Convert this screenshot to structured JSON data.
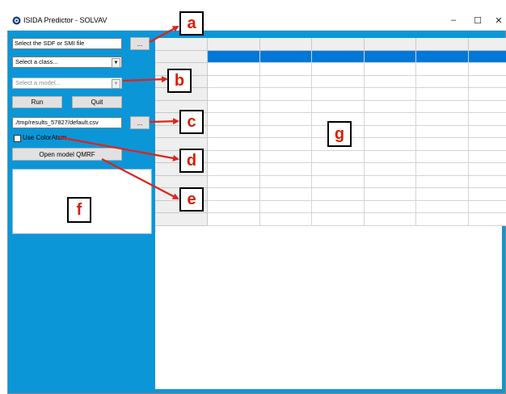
{
  "window": {
    "title": "ISIDA Predictor - SOLVAV",
    "controls": {
      "minimize": "–",
      "maximize": "☐",
      "close": "✕"
    }
  },
  "left_panel": {
    "file_field": "Select the SDF or SMI file",
    "browse_label": "...",
    "class_combo": "Select a class...",
    "model_combo": "Select a model...",
    "run_label": "Run",
    "quit_label": "Quit",
    "output_path": "./tmp/results_57827/default.csv",
    "output_browse_label": "...",
    "use_coloratom_label": "Use ColorAtom",
    "use_coloratom_checked": false,
    "open_qmrf_label": "Open model QMRF"
  },
  "grid": {
    "columns": 6,
    "rows": 14,
    "selected_row": 1
  },
  "callouts": {
    "a": "a",
    "b": "b",
    "c": "c",
    "d": "d",
    "e": "e",
    "f": "f",
    "g": "g"
  },
  "colors": {
    "window_background": "#0b96d8",
    "selection": "#0078d7",
    "callout_arrow": "#e0221b",
    "callout_letter": "#d81e05"
  },
  "icons": {
    "app": "gear-like-app-icon",
    "combo_arrow": "dropdown-arrow-icon"
  }
}
